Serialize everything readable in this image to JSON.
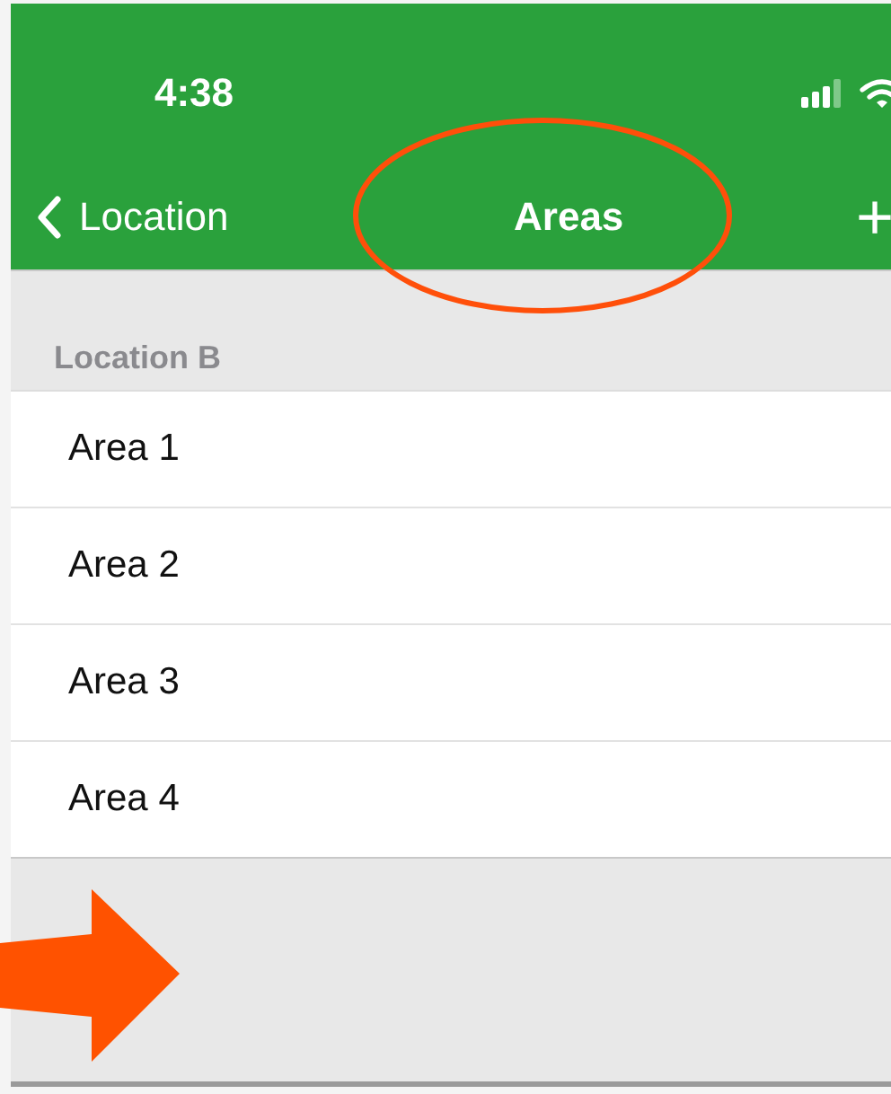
{
  "status_bar": {
    "time": "4:38"
  },
  "nav_bar": {
    "back_label": "Location",
    "title": "Areas",
    "add_label": "+"
  },
  "section": {
    "header": "Location B",
    "rows": [
      {
        "label": "Area 1"
      },
      {
        "label": "Area 2"
      },
      {
        "label": "Area 3"
      },
      {
        "label": "Area 4"
      }
    ]
  }
}
